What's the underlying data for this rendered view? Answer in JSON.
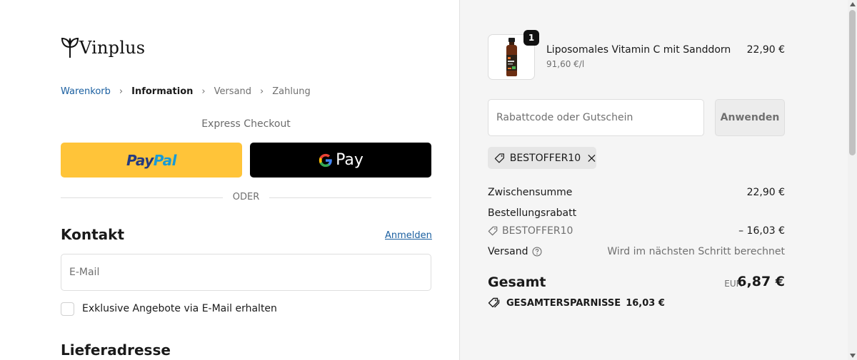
{
  "brand": {
    "name": "Vinplus"
  },
  "breadcrumb": {
    "items": [
      {
        "label": "Warenkorb",
        "state": "link"
      },
      {
        "label": "Information",
        "state": "current"
      },
      {
        "label": "Versand",
        "state": "muted"
      },
      {
        "label": "Zahlung",
        "state": "muted"
      }
    ]
  },
  "express": {
    "title": "Express Checkout",
    "paypal_part1": "Pay",
    "paypal_part2": "Pal",
    "gpay_label": "Pay",
    "divider": "ODER"
  },
  "contact": {
    "title": "Kontakt",
    "login_link": "Anmelden",
    "email_placeholder": "E-Mail",
    "newsletter_label": "Exklusive Angebote via E-Mail erhalten",
    "newsletter_checked": false
  },
  "shipping": {
    "title": "Lieferadresse"
  },
  "cart": {
    "item": {
      "name": "Liposomales Vitamin C mit Sanddorn",
      "unit_price": "91,60 €/l",
      "price": "22,90 €",
      "quantity": "1"
    },
    "discount_placeholder": "Rabattcode oder Gutschein",
    "apply_label": "Anwenden",
    "applied_code": "BESTOFFER10"
  },
  "summary": {
    "subtotal_label": "Zwischensumme",
    "subtotal_value": "22,90 €",
    "discount_label": "Bestellungsrabatt",
    "discount_code": "BESTOFFER10",
    "discount_value": "– 16,03 €",
    "shipping_label": "Versand",
    "shipping_value": "Wird im nächsten Schritt berechnet",
    "total_label": "Gesamt",
    "total_currency": "EUR",
    "total_value": "6,87 €",
    "savings_label": "GESAMTERSPARNISSE",
    "savings_value": "16,03 €"
  },
  "colors": {
    "link": "#1a5fa0",
    "paypal_bg": "#ffc439",
    "gpay_bg": "#000000",
    "sidebar_bg": "#f5f5f5"
  }
}
